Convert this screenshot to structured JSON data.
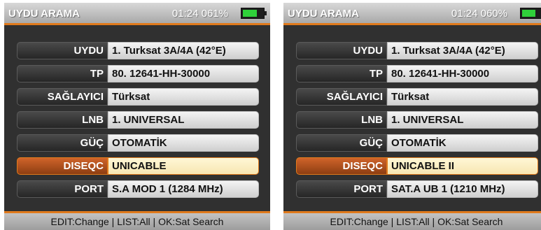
{
  "screens": [
    {
      "header": {
        "title": "UYDU ARAMA",
        "time": "01:24",
        "battery": "061%"
      },
      "rows": [
        {
          "label": "UYDU",
          "value": "1. Turksat 3A/4A (42°E)"
        },
        {
          "label": "TP",
          "value": "80. 12641-HH-30000"
        },
        {
          "label": "SAĞLAYICI",
          "value": "Türksat"
        },
        {
          "label": "LNB",
          "value": "1. UNIVERSAL"
        },
        {
          "label": "GÜÇ",
          "value": "OTOMATİK"
        },
        {
          "label": "DISEQC",
          "value": "UNICABLE"
        },
        {
          "label": "PORT",
          "value": "S.A MOD 1 (1284 MHz)"
        }
      ],
      "footer": "EDIT:Change | LIST:All | OK:Sat Search"
    },
    {
      "header": {
        "title": "UYDU ARAMA",
        "time": "01:24",
        "battery": "060%"
      },
      "rows": [
        {
          "label": "UYDU",
          "value": "1. Turksat 3A/4A (42°E)"
        },
        {
          "label": "TP",
          "value": "80. 12641-HH-30000"
        },
        {
          "label": "SAĞLAYICI",
          "value": "Türksat"
        },
        {
          "label": "LNB",
          "value": "1. UNIVERSAL"
        },
        {
          "label": "GÜÇ",
          "value": "OTOMATİK"
        },
        {
          "label": "DISEQC",
          "value": "UNICABLE II"
        },
        {
          "label": "PORT",
          "value": "SAT.A UB 1 (1210 MHz)"
        }
      ],
      "footer": "EDIT:Change | LIST:All | OK:Sat Search"
    }
  ],
  "active_row": "DISEQC",
  "colors": {
    "accent": "#e07a1c",
    "battery": "#2fd13a"
  }
}
